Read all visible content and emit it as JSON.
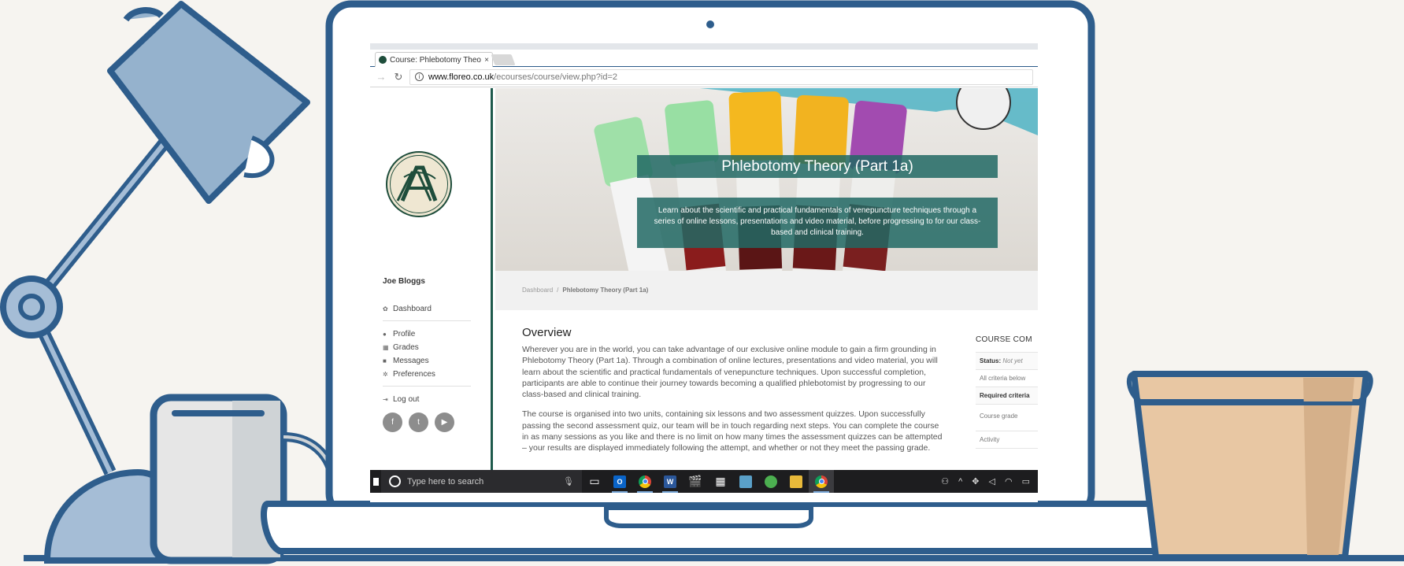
{
  "browser": {
    "tab_title": "Course: Phlebotomy Theo",
    "tab_close": "×",
    "url_host": "www.floreo.co.uk",
    "url_path": "/ecourses/course/view.php?id=2",
    "back_icon": "back-arrow-icon",
    "reload_icon": "reload-icon"
  },
  "sidebar": {
    "logo_letters": "AA",
    "username": "Joe Bloggs",
    "dashboard": "Dashboard",
    "items": [
      {
        "label": "Profile",
        "icon": "user-icon"
      },
      {
        "label": "Grades",
        "icon": "table-icon"
      },
      {
        "label": "Messages",
        "icon": "chat-icon"
      },
      {
        "label": "Preferences",
        "icon": "gear-icon"
      }
    ],
    "logout": "Log out",
    "social": {
      "facebook": "f",
      "twitter": "t",
      "youtube": "▶"
    }
  },
  "hero": {
    "title": "Phlebotomy Theory (Part 1a)",
    "description": "Learn about the scientific and practical fundamentals of venepuncture techniques through a series of online lessons, presentations and video material, before progressing to for our class-based and clinical training."
  },
  "breadcrumb": {
    "home": "Dashboard",
    "separator": "/",
    "current": "Phlebotomy Theory (Part 1a)"
  },
  "content": {
    "heading": "Overview",
    "paragraphs": [
      "Wherever you are in the world, you can take advantage of our exclusive online module to gain a firm grounding in Phlebotomy Theory (Part 1a). Through a combination of online lectures, presentations and video material, you will learn about the scientific and practical fundamentals of venepuncture techniques. Upon successful completion, participants are able to continue their journey towards becoming a qualified phlebotomist by progressing to our class-based and clinical training.",
      "The course is organised into two units, containing six lessons and two assessment quizzes. Upon successfully passing the second assessment quiz, our team will be in touch regarding next steps. You can complete the course in as many sessions as you like and there is no limit on how many times the assessment quizzes can be attempted – your results are displayed immediately following the attempt, and whether or not they meet the passing grade."
    ]
  },
  "completion": {
    "title": "COURSE COM",
    "status_label": "Status:",
    "status_value": "Not yet",
    "criteria_below": "All criteria below",
    "required": "Required criteria",
    "course_grade": "Course grade",
    "activity": "Activity"
  },
  "taskbar": {
    "search_placeholder": "Type here to search",
    "word_letter": "W",
    "outlook_letter": "O"
  },
  "colors": {
    "frame": "#2e5d8c",
    "hero_box": "#216964",
    "sidebar_accent": "#1e5a4c"
  }
}
